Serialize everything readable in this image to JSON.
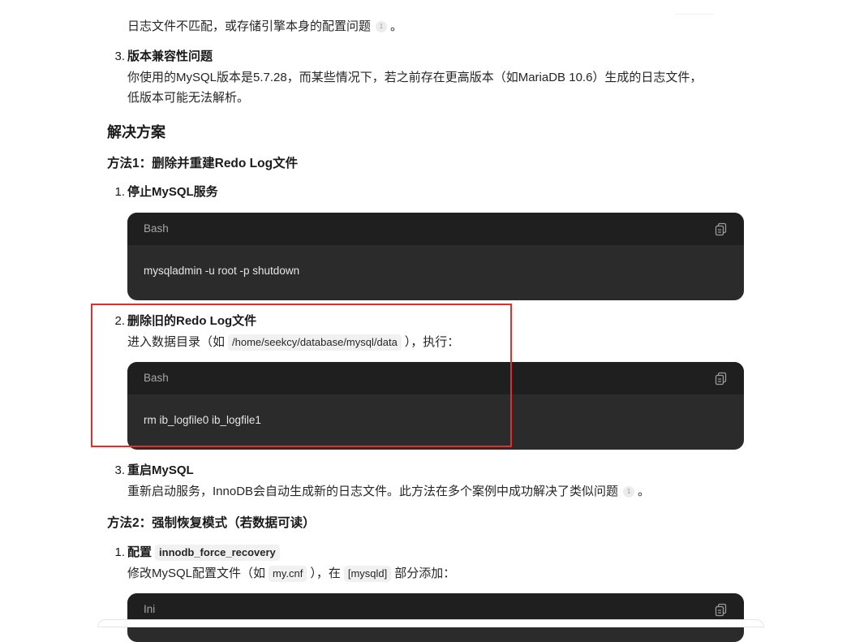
{
  "top_faint_bar": "",
  "para_top": {
    "text": "日志文件不匹配，或存储引擎本身的配置问题",
    "cite": "1",
    "tail": "。"
  },
  "item_cause3": {
    "num": "3.",
    "title": "版本兼容性问题",
    "line1": "你使用的MySQL版本是5.7.28，而某些情况下，若之前存在更高版本（如MariaDB 10.6）生成的日志文件，",
    "line2": "低版本可能无法解析。"
  },
  "solutions_heading": "解决方案",
  "method1": {
    "title": "方法1：删除并重建Redo Log文件",
    "step1": {
      "num": "1.",
      "title": "停止MySQL服务",
      "code": {
        "lang": "Bash",
        "line": "mysqladmin -u root -p shutdown"
      }
    },
    "step2": {
      "num": "2.",
      "title": "删除旧的Redo Log文件",
      "desc_pre": "进入数据目录（如",
      "desc_code": "/home/seekcy/database/mysql/data",
      "desc_post": "），执行：",
      "code": {
        "lang": "Bash",
        "line": "rm ib_logfile0 ib_logfile1"
      }
    },
    "step3": {
      "num": "3.",
      "title": "重启MySQL",
      "desc": "重新启动服务，InnoDB会自动生成新的日志文件。此方法在多个案例中成功解决了类似问题",
      "cite": "1",
      "tail": "。"
    }
  },
  "method2": {
    "title": "方法2：强制恢复模式（若数据可读）",
    "step1": {
      "num": "1.",
      "title_pre": "配置",
      "title_code": "innodb_force_recovery",
      "desc_pre": "修改MySQL配置文件（如",
      "desc_code1": "my.cnf",
      "desc_mid": "），在",
      "desc_code2": "[mysqld]",
      "desc_post": "部分添加：",
      "code": {
        "lang": "Ini"
      }
    }
  },
  "colors": {
    "highlight_border": "#e0302e",
    "code_bg": "#2b2b2b",
    "code_header_bg": "#1f1f1f"
  },
  "icons": {
    "copy": "copy-icon"
  }
}
